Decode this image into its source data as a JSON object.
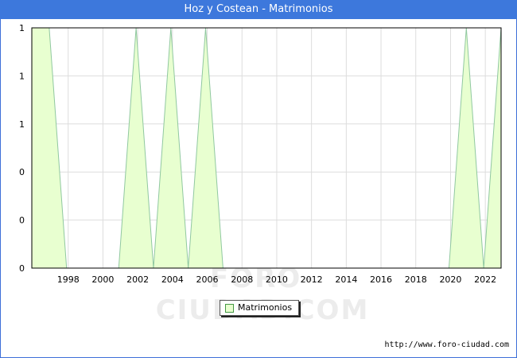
{
  "page": {
    "title": "Hoz y Costean - Matrimonios",
    "watermark": "FORO-CIUDAD.COM",
    "source": "http://www.foro-ciudad.com"
  },
  "colors": {
    "accent": "#3d78dc",
    "fill": "#e8ffd0",
    "line": "#90c8a0",
    "grid": "#dddddd"
  },
  "chart_data": {
    "type": "area",
    "title": "Hoz y Costean - Matrimonios",
    "x": [
      1996,
      1997,
      1998,
      1999,
      2000,
      2001,
      2002,
      2003,
      2004,
      2005,
      2006,
      2007,
      2008,
      2009,
      2010,
      2011,
      2012,
      2013,
      2014,
      2015,
      2016,
      2017,
      2018,
      2019,
      2020,
      2021,
      2022,
      2023
    ],
    "series": [
      {
        "name": "Matrimonios",
        "values": [
          1,
          1,
          0,
          0,
          0,
          0,
          1,
          0,
          1,
          0,
          1,
          0,
          0,
          0,
          0,
          0,
          0,
          0,
          0,
          0,
          0,
          0,
          0,
          0,
          0,
          1,
          0,
          1
        ]
      }
    ],
    "xlim": [
      1996,
      2023
    ],
    "ylim": [
      0,
      1
    ],
    "x_ticks": [
      "1998",
      "2000",
      "2002",
      "2004",
      "2006",
      "2008",
      "2010",
      "2012",
      "2014",
      "2016",
      "2018",
      "2020",
      "2022"
    ],
    "y_tick_labels": [
      "0",
      "0",
      "0",
      "1",
      "1",
      "1"
    ],
    "grid": true,
    "legend": "bottom-center",
    "xlabel": "",
    "ylabel": ""
  }
}
